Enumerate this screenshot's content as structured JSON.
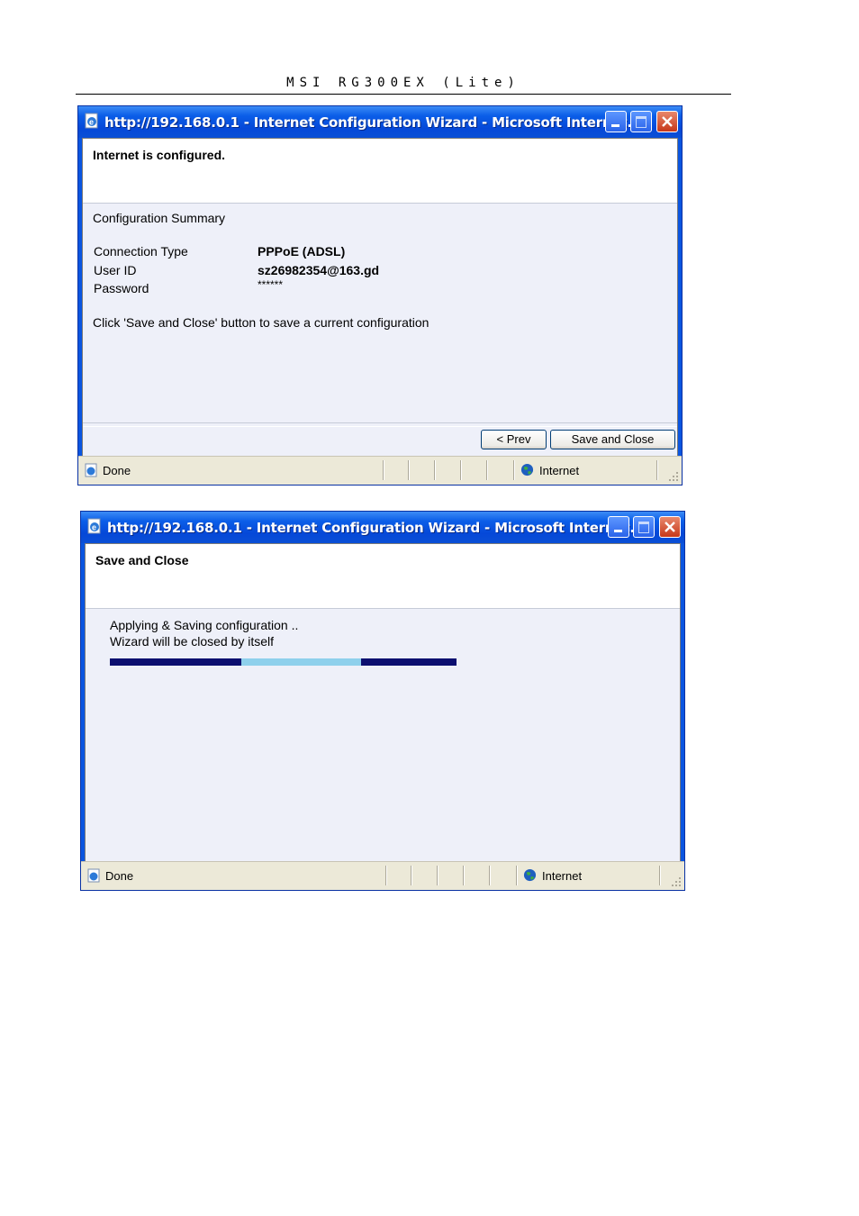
{
  "document": {
    "header": "MSI RG300EX (Lite)"
  },
  "window1": {
    "title": "http://192.168.0.1 - Internet Configuration Wizard - Microsoft Internet...",
    "heading": "Internet is configured.",
    "summary_title": "Configuration Summary",
    "rows": [
      {
        "label": "Connection Type",
        "value": "PPPoE (ADSL)"
      },
      {
        "label": "User ID",
        "value": "sz26982354@163.gd"
      },
      {
        "label": "Password",
        "value": "******"
      }
    ],
    "instruction": "Click 'Save and Close' button to save a current configuration",
    "buttons": {
      "prev": "< Prev",
      "save_close": "Save and Close"
    },
    "status": {
      "text": "Done",
      "zone": "Internet"
    }
  },
  "window2": {
    "title": "http://192.168.0.1 - Internet Configuration Wizard - Microsoft Internet...",
    "heading": "Save and Close",
    "line1": "Applying & Saving configuration ..",
    "line2": "Wizard will be closed by itself",
    "progress": {
      "segment_start": 0.38,
      "segment_end": 0.725,
      "bar_color": "#0c0f70",
      "segment_color": "#8ed0ec"
    },
    "status": {
      "text": "Done",
      "zone": "Internet"
    }
  },
  "icons": {
    "title_icon": "ie-page-icon",
    "minimize": "minimize-icon",
    "maximize": "maximize-icon",
    "close": "close-icon",
    "status_icon": "ie-done-icon",
    "zone_icon": "globe-icon",
    "grip": "resize-grip-icon"
  },
  "colors": {
    "titlebar": "#0548d8",
    "client_bg": "#eef0f9",
    "statusbar": "#ece9d8",
    "close_button": "#c6381a"
  }
}
